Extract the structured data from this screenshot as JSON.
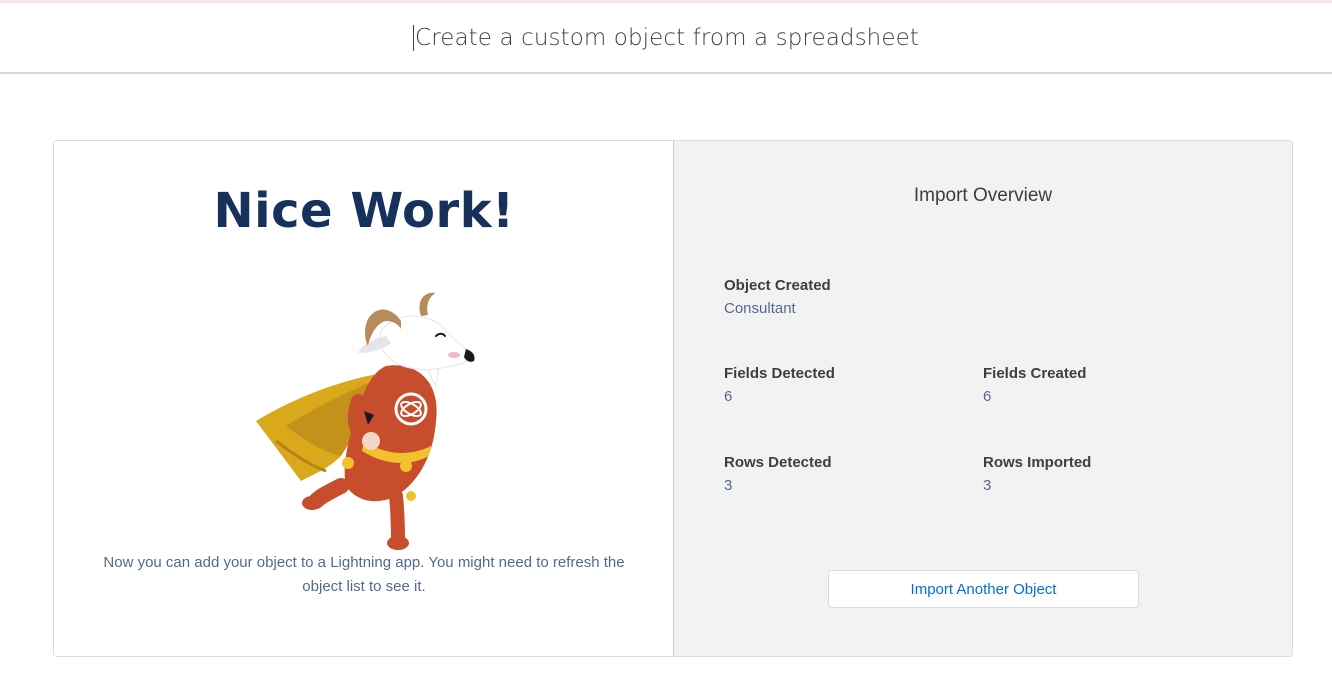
{
  "header": {
    "title": "Create a custom object from a spreadsheet"
  },
  "success_panel": {
    "heading": "Nice Work!",
    "mascot_icon": "caped-goat-mascot-icon",
    "message": "Now you can add your object to a Lightning app. You might need to refresh the object list to see it."
  },
  "overview": {
    "title": "Import Overview",
    "object_created": {
      "label": "Object Created",
      "value": "Consultant"
    },
    "fields_detected": {
      "label": "Fields Detected",
      "value": "6"
    },
    "fields_created": {
      "label": "Fields Created",
      "value": "6"
    },
    "rows_detected": {
      "label": "Rows Detected",
      "value": "3"
    },
    "rows_imported": {
      "label": "Rows Imported",
      "value": "3"
    },
    "import_another_label": "Import Another Object"
  },
  "colors": {
    "heading": "#16325c",
    "link_blue": "#0070d2",
    "panel_bg": "#f3f2f2",
    "cape_gold": "#d9a81b",
    "suit_red": "#c84d2c"
  }
}
